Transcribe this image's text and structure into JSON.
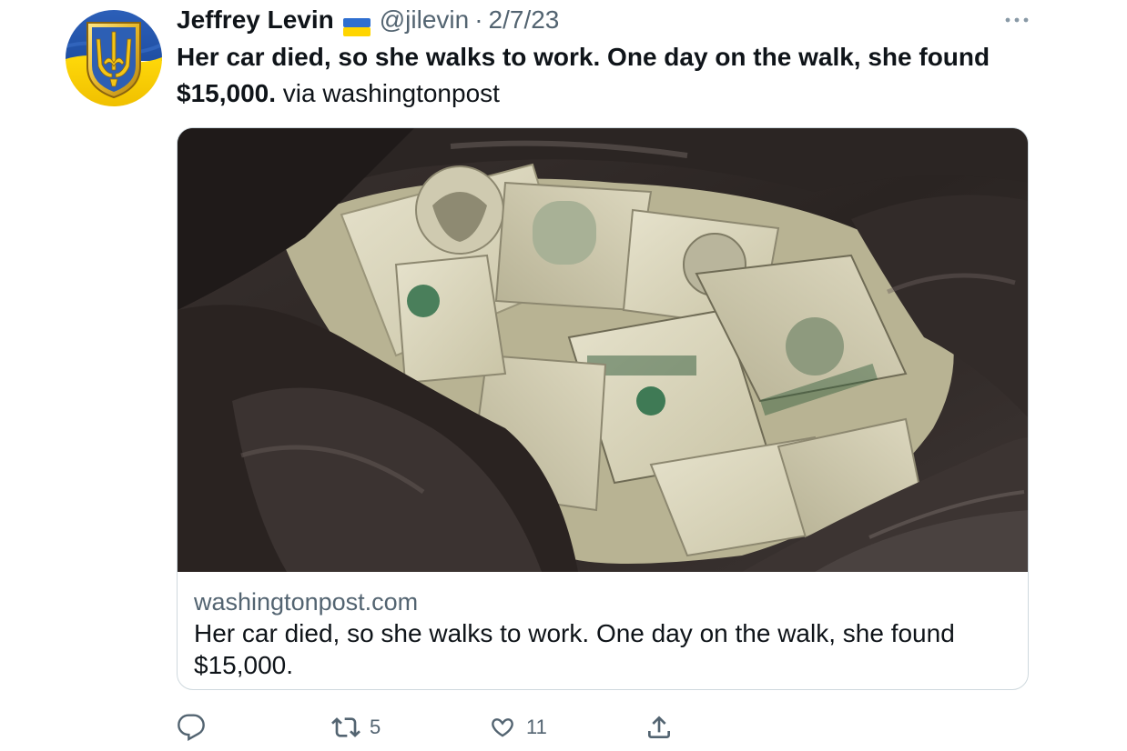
{
  "tweet": {
    "author_name": "Jeffrey Levin",
    "flag_icon": "ukraine-flag-icon",
    "handle": "@jilevin",
    "separator": "·",
    "date": "2/7/23",
    "text_bold": "Her car died, so she walks to work. One day on the walk, she found $15,000.",
    "text_rest": " via washingtonpost",
    "avatar_icon": "ukrainian-trident-avatar"
  },
  "card": {
    "image_icon": "money-in-trash-bag-image",
    "domain": "washingtonpost.com",
    "title": "Her car died, so she walks to work. One day on the walk, she found $15,000."
  },
  "actions": {
    "reply_icon": "reply-icon",
    "retweet_icon": "retweet-icon",
    "retweet_count": "5",
    "like_icon": "heart-icon",
    "like_count": "11",
    "share_icon": "share-icon"
  },
  "colors": {
    "primary_text": "#0f1419",
    "secondary_text": "#536471",
    "border": "#cfd9de"
  }
}
